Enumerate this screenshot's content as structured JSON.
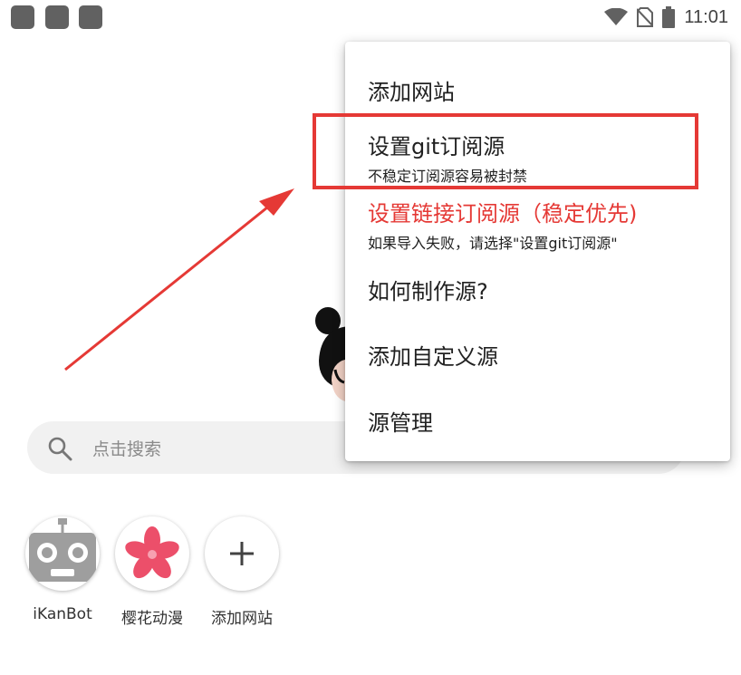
{
  "status_bar": {
    "time": "11:01",
    "icons": [
      "app-icon",
      "app-icon",
      "app-icon",
      "wifi-icon",
      "no-sim-icon",
      "battery-icon"
    ]
  },
  "search": {
    "placeholder": "点击搜索",
    "icon": "search-icon"
  },
  "shortcuts": [
    {
      "label": "iKanBot",
      "icon": "robot-icon"
    },
    {
      "label": "樱花动漫",
      "icon": "sakura-flower-icon"
    },
    {
      "label": "添加网站",
      "icon": "plus-icon"
    }
  ],
  "menu": {
    "items": [
      {
        "title": "添加网站",
        "subtitle": ""
      },
      {
        "title": "设置git订阅源",
        "subtitle": "不稳定订阅源容易被封禁",
        "highlighted": true
      },
      {
        "title": "设置链接订阅源（稳定优先)",
        "subtitle": "如果导入失败，请选择\"设置git订阅源\"",
        "color": "#e53935"
      },
      {
        "title": "如何制作源?",
        "subtitle": ""
      },
      {
        "title": "添加自定义源",
        "subtitle": ""
      },
      {
        "title": "源管理",
        "subtitle": ""
      }
    ]
  },
  "colors": {
    "annotation": "#e53935",
    "search_bg": "#f1f1f1",
    "menu_bg": "#ffffff"
  }
}
